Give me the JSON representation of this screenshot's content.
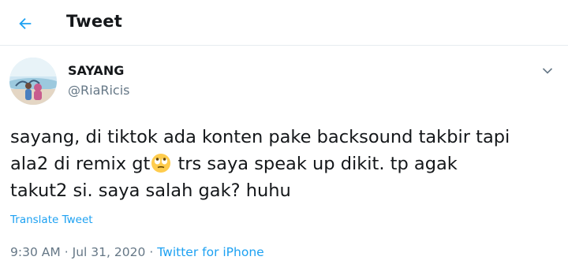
{
  "header": {
    "title": "Tweet",
    "back_icon": "arrow-left-icon"
  },
  "author": {
    "name": "SAYANG",
    "handle": "@RiaRicis"
  },
  "tweet": {
    "lines": [
      "sayang, di tiktok ada konten pake backsound takbir tapi",
      "ala2 di remix gt",
      "trs saya speak up dikit. tp agak",
      "takut2 si. saya salah gak? huhu"
    ],
    "emoji": "face-with-rolling-eyes-icon"
  },
  "translate_label": "Translate Tweet",
  "meta": {
    "time": "9:30 AM",
    "separator": "·",
    "date": "Jul 31, 2020",
    "source": "Twitter for iPhone"
  },
  "colors": {
    "accent": "#1da1f2",
    "text": "#14171a",
    "muted": "#657786",
    "border": "#e6ecf0"
  }
}
